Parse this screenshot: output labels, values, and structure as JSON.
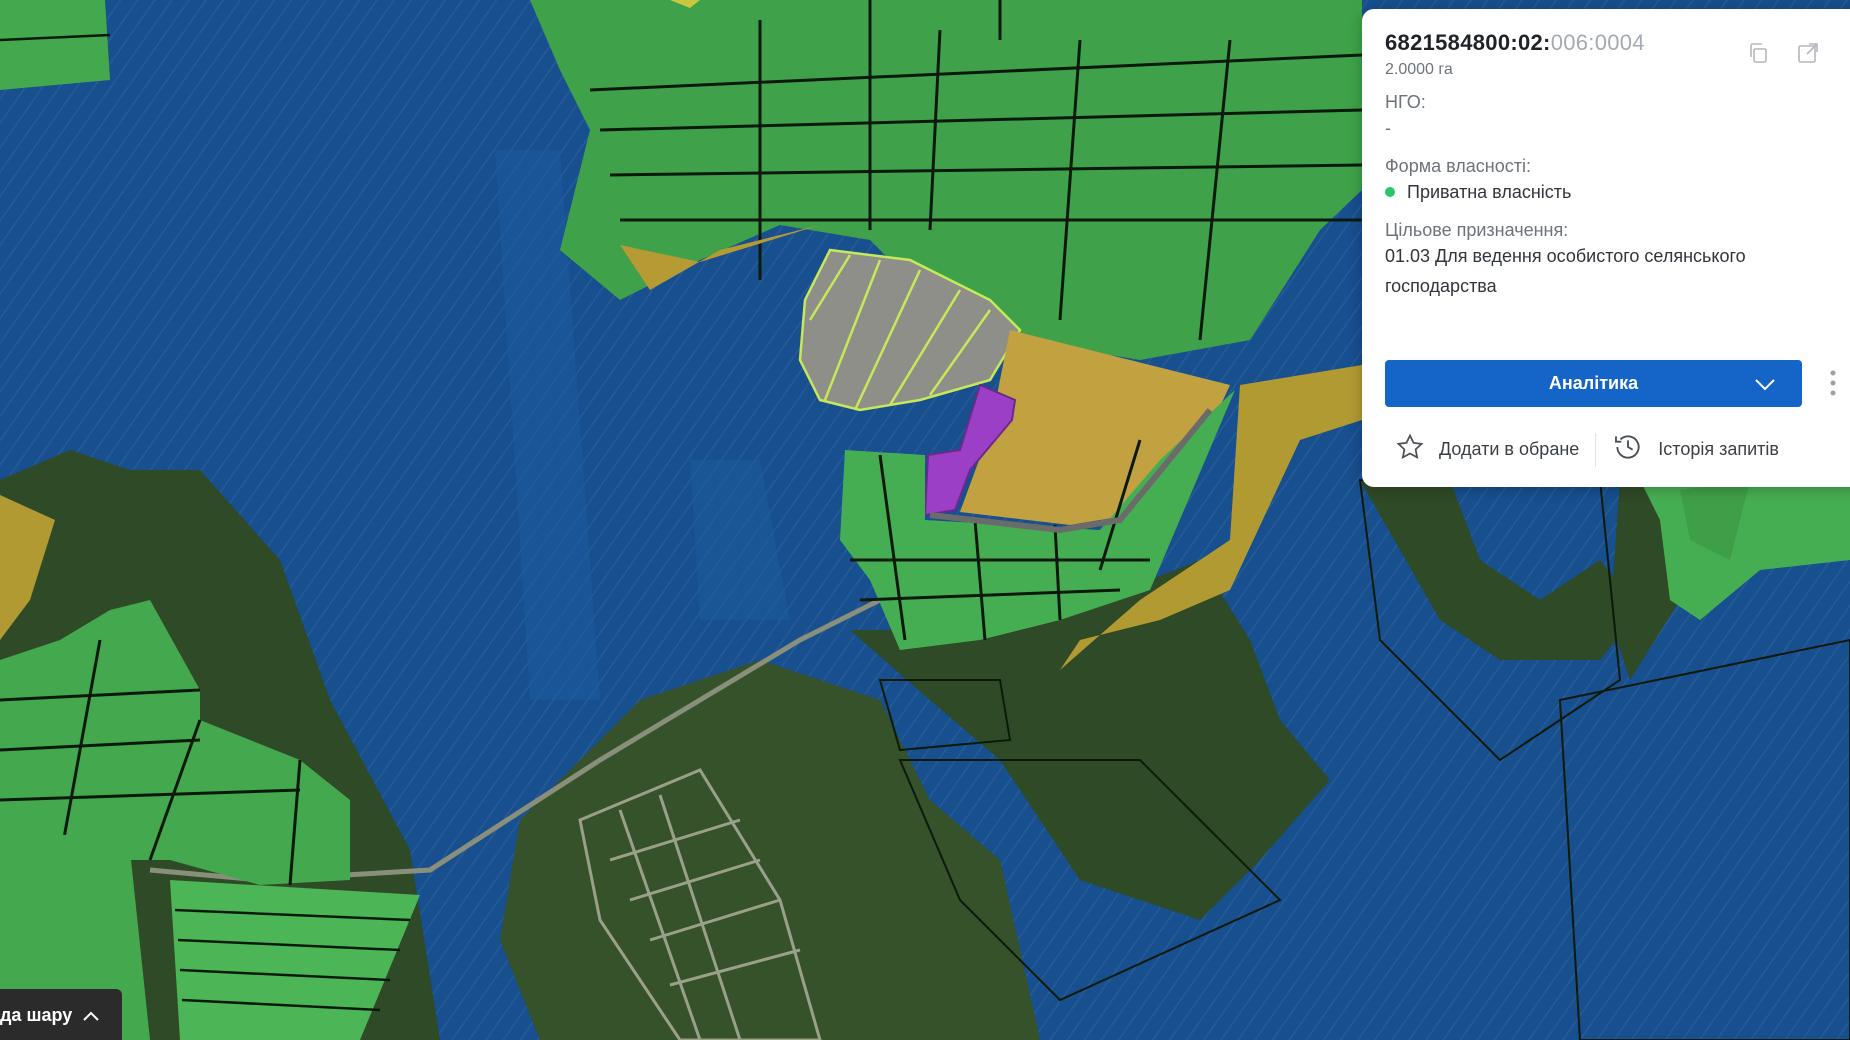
{
  "map": {
    "colors": {
      "forest": "#174f8f",
      "agri": "#3fae4f",
      "pasture": "#b9a43a",
      "selected": "#9b3fc7",
      "wood": "#2d4a22"
    }
  },
  "panel": {
    "cadastral_bold": "6821584800:02:",
    "cadastral_muted": "006:0004",
    "area": "2.0000 га",
    "ngo_label": "НГО:",
    "ngo_value": "-",
    "ownership_label": "Форма власності:",
    "ownership_value": "Приватна власність",
    "ownership_color": "#28c76f",
    "purpose_label": "Цільове призначення:",
    "purpose_value": "01.03 Для ведення особистого селянського господарства",
    "analytics_button": "Аналітика",
    "favorite_label": "Додати в обране",
    "history_label": "Історія запитів",
    "icons": [
      "copy-icon",
      "external-link-icon",
      "close-icon",
      "chevron-down-icon",
      "more-vertical-icon",
      "star-icon",
      "history-icon"
    ]
  },
  "layer_toggle": {
    "label": "да шару"
  }
}
